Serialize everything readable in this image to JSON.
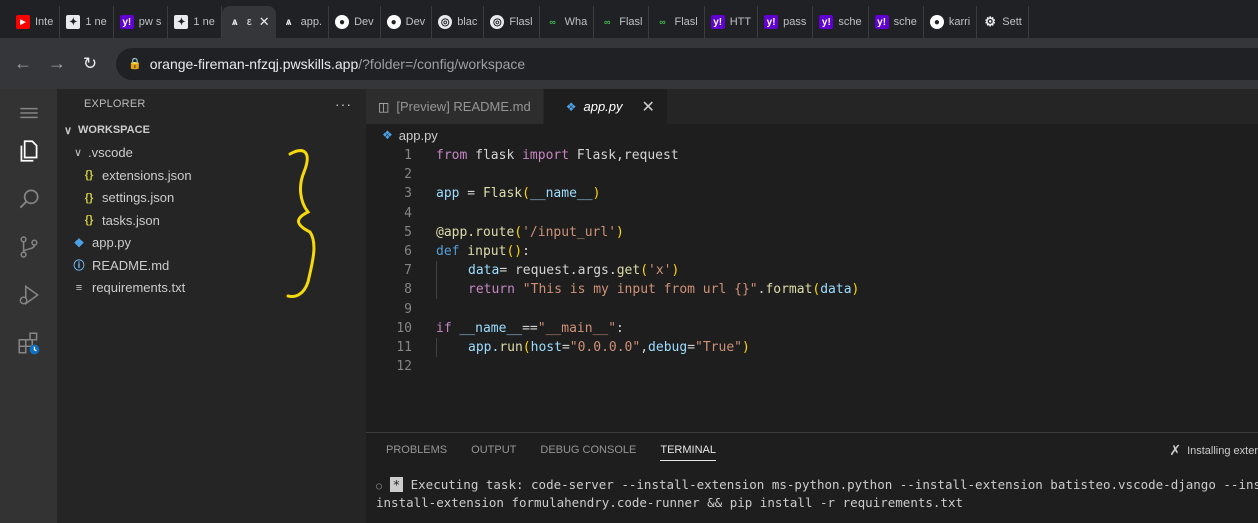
{
  "browser": {
    "tabs": [
      {
        "icon": "youtube-icon",
        "title": "Inte",
        "active": false
      },
      {
        "icon": "chatgpt-icon",
        "title": "1 ne",
        "active": false
      },
      {
        "icon": "yahoo-icon",
        "title": "pw s",
        "active": false
      },
      {
        "icon": "chatgpt-icon",
        "title": "1 ne",
        "active": false
      },
      {
        "icon": "pwskills-icon",
        "title": "ε",
        "active": true
      },
      {
        "icon": "pwskills-icon",
        "title": "app.",
        "active": false
      },
      {
        "icon": "github-icon",
        "title": "Dev",
        "active": false
      },
      {
        "icon": "github-icon",
        "title": "Dev",
        "active": false
      },
      {
        "icon": "chrome-icon",
        "title": "blac",
        "active": false
      },
      {
        "icon": "chrome-icon",
        "title": "Flasl",
        "active": false
      },
      {
        "icon": "green-icon",
        "title": "Wha",
        "active": false
      },
      {
        "icon": "green-icon",
        "title": "Flasl",
        "active": false
      },
      {
        "icon": "green-icon",
        "title": "Flasl",
        "active": false
      },
      {
        "icon": "yahoo-icon",
        "title": "HTT",
        "active": false
      },
      {
        "icon": "yahoo-icon",
        "title": "pass",
        "active": false
      },
      {
        "icon": "yahoo-icon",
        "title": "sche",
        "active": false
      },
      {
        "icon": "yahoo-icon",
        "title": "sche",
        "active": false
      },
      {
        "icon": "github-icon",
        "title": "karri",
        "active": false
      },
      {
        "icon": "gear-icon",
        "title": "Sett",
        "active": false
      }
    ],
    "url_host": "orange-fireman-nfzqj.pwskills.app",
    "url_path": "/?folder=/config/workspace"
  },
  "sidebar": {
    "title": "EXPLORER",
    "more": "···",
    "section": "WORKSPACE",
    "folder": ".vscode",
    "folder_files": [
      "extensions.json",
      "settings.json",
      "tasks.json"
    ],
    "files": [
      "app.py",
      "README.md",
      "requirements.txt"
    ]
  },
  "editor": {
    "tabs": [
      {
        "label": "[Preview] README.md",
        "active": false
      },
      {
        "label": "app.py",
        "active": true
      }
    ],
    "breadcrumb": "app.py",
    "line_numbers": [
      "1",
      "2",
      "3",
      "4",
      "5",
      "6",
      "7",
      "8",
      "9",
      "10",
      "11",
      "12"
    ],
    "code": {
      "l1_from": "from",
      "l1_mod": " flask ",
      "l1_import": "import",
      "l1_rest": " Flask,request",
      "l3_var": "app",
      "l3_eq": " = ",
      "l3_fn": "Flask",
      "l3_open": "(",
      "l3_name": "__name__",
      "l3_close": ")",
      "l5_dec": "@app.route",
      "l5_open": "(",
      "l5_str": "'/input_url'",
      "l5_close": ")",
      "l6_def": "def",
      "l6_fn": " input",
      "l6_paren": "()",
      "l6_colon": ":",
      "l7_var": "data",
      "l7_rest": "= request.args.",
      "l7_fn": "get",
      "l7_open": "(",
      "l7_str": "'x'",
      "l7_close": ")",
      "l8_ret": "return",
      "l8_str": " \"This is my input from url {}\"",
      "l8_dot": ".",
      "l8_fn": "format",
      "l8_open": "(",
      "l8_arg": "data",
      "l8_close": ")",
      "l10_if": "if",
      "l10_name": " __name__",
      "l10_eq": "==",
      "l10_str": "\"__main__\"",
      "l10_colon": ":",
      "l11_obj": "app.",
      "l11_fn": "run",
      "l11_open": "(",
      "l11_k1": "host",
      "l11_e1": "=",
      "l11_v1": "\"0.0.0.0\"",
      "l11_comma": ",",
      "l11_k2": "debug",
      "l11_e2": "=",
      "l11_v2": "\"True\"",
      "l11_close": ")"
    }
  },
  "panel": {
    "tabs": [
      "PROBLEMS",
      "OUTPUT",
      "DEBUG CONSOLE",
      "TERMINAL"
    ],
    "status": "Installing exter",
    "terminal_line1": " Executing task: code-server --install-extension ms-python.python --install-extension batisteo.vscode-django --ins",
    "terminal_line2": "install-extension formulahendry.code-runner && pip install -r requirements.txt",
    "terminal_star": "*"
  },
  "colors": {
    "activity_bar": "#333333",
    "sidebar": "#252526",
    "editor": "#1e1e1e",
    "annotation": "#f5d90a"
  }
}
